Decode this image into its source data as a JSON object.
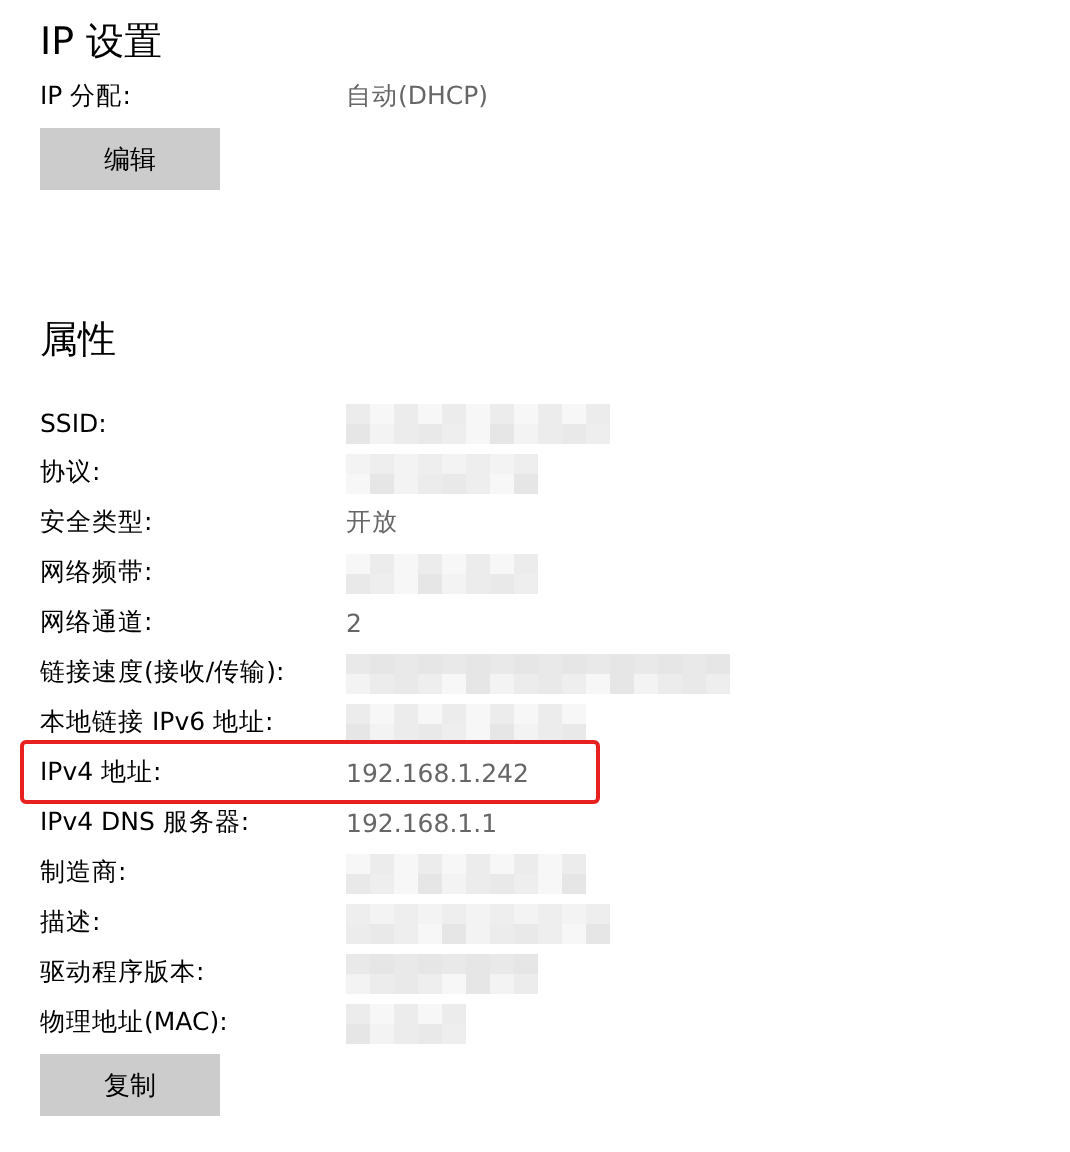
{
  "ip_settings": {
    "title": "IP 设置",
    "assignment": {
      "label": "IP 分配:",
      "value": "自动(DHCP)"
    },
    "button": "编辑"
  },
  "properties": {
    "title": "属性",
    "rows": [
      {
        "label": "SSID:",
        "redacted": true,
        "highlighted": false
      },
      {
        "label": "协议:",
        "redacted": true,
        "highlighted": false
      },
      {
        "label": "安全类型:",
        "value": "开放",
        "redacted": false,
        "highlighted": false
      },
      {
        "label": "网络频带:",
        "redacted": true,
        "highlighted": false
      },
      {
        "label": "网络通道:",
        "value": "2",
        "redacted": false,
        "highlighted": false
      },
      {
        "label": "链接速度(接收/传输):",
        "redacted": true,
        "highlighted": false
      },
      {
        "label": "本地链接 IPv6 地址:",
        "redacted": true,
        "highlighted": false
      },
      {
        "label": "IPv4 地址:",
        "value": "192.168.1.242",
        "redacted": false,
        "highlighted": true
      },
      {
        "label": "IPv4 DNS 服务器:",
        "value": "192.168.1.1",
        "redacted": false,
        "highlighted": false
      },
      {
        "label": "制造商:",
        "redacted": true,
        "highlighted": false
      },
      {
        "label": "描述:",
        "redacted": true,
        "highlighted": false
      },
      {
        "label": "驱动程序版本:",
        "redacted": true,
        "highlighted": false
      },
      {
        "label": "物理地址(MAC):",
        "redacted": true,
        "highlighted": false
      }
    ],
    "button": "复制"
  }
}
